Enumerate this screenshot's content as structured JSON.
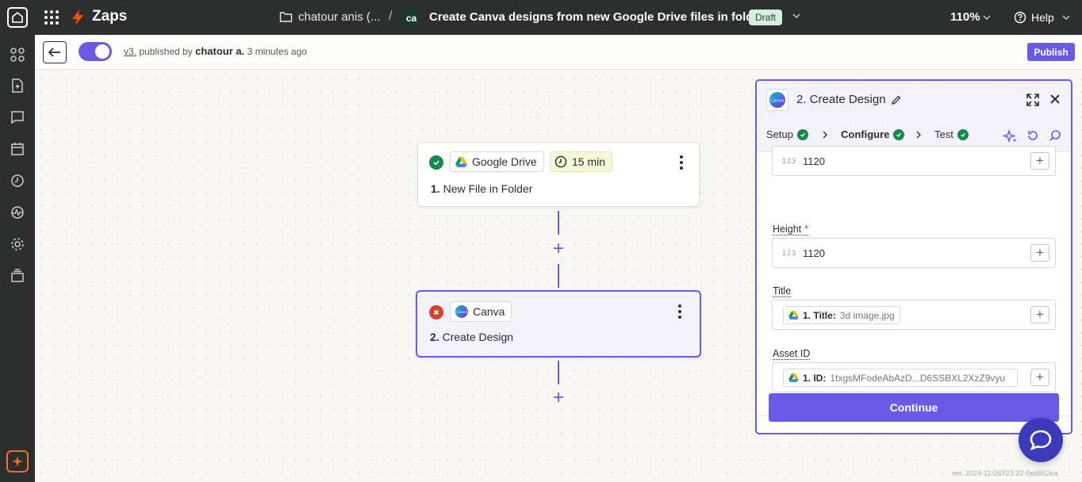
{
  "topbar": {
    "app_title": "Zaps",
    "folder_name": "chatour anis (...",
    "separator": "/",
    "avatar_initials": "ca",
    "zap_title": "Create Canva designs from new Google Drive files in folder",
    "status_badge": "Draft",
    "zoom": "110%",
    "help_label": "Help"
  },
  "subbar": {
    "version": "v3.",
    "published_by": "published by",
    "author": "chatour a.",
    "time_ago": "3 minutes ago",
    "publish_label": "Publish"
  },
  "canvas": {
    "trigger": {
      "app": "Google Drive",
      "poll_interval": "15 min",
      "step_number": "1.",
      "step_name": "New File in Folder"
    },
    "action": {
      "app": "Canva",
      "step_number": "2.",
      "step_name": "Create Design"
    }
  },
  "panel": {
    "title": "2. Create Design",
    "tabs": [
      {
        "label": "Setup"
      },
      {
        "label": "Configure"
      },
      {
        "label": "Test"
      }
    ],
    "fields": {
      "width_value": "1120",
      "height_label": "Height",
      "height_required": "*",
      "height_value": "1120",
      "title_label": "Title",
      "title_pill_key": "1. Title:",
      "title_pill_value": "3d image.jpg",
      "asset_label": "Asset ID",
      "asset_pill_key": "1. ID:",
      "asset_pill_value": "1txgsMFodeAbAzD...D6SSBXL2XzZ9vyu"
    },
    "num_icon_text": "123",
    "continue_label": "Continue"
  },
  "footer": {
    "build_version": "ver. 2024-11-26T23:22-0ad852ea"
  },
  "colors": {
    "accent": "#695be8",
    "success": "#158a4a",
    "error": "#d4432f",
    "zapier_orange": "#ff4f00"
  }
}
